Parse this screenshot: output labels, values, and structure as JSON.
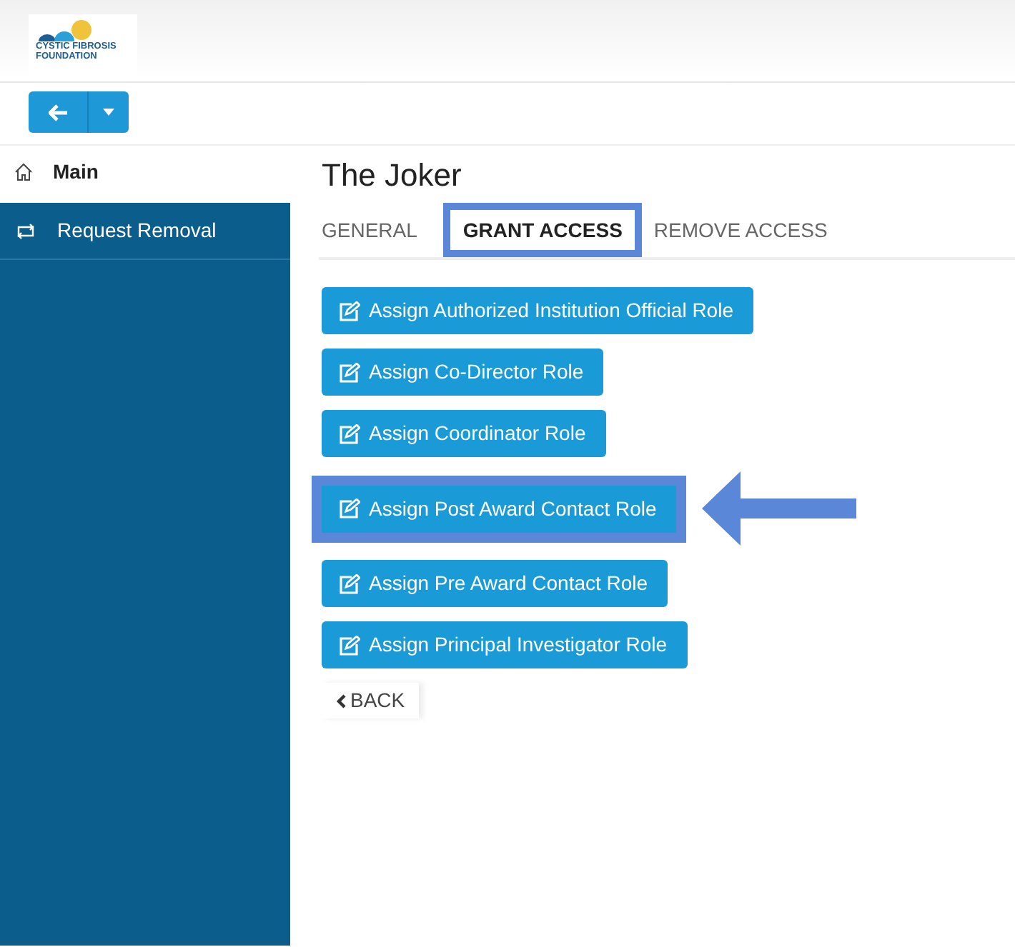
{
  "logo": {
    "line_1": "CYSTIC FIBROSIS",
    "line_2": "FOUNDATION"
  },
  "sidebar": {
    "items": [
      {
        "label": "Main",
        "selected": false
      },
      {
        "label": "Request Removal",
        "selected": true
      }
    ]
  },
  "page": {
    "title": "The Joker",
    "tabs": [
      {
        "label": "GENERAL",
        "selected": false,
        "highlighted": false
      },
      {
        "label": "GRANT ACCESS",
        "selected": true,
        "highlighted": true
      },
      {
        "label": "REMOVE ACCESS",
        "selected": false,
        "highlighted": false
      }
    ],
    "buttons": [
      {
        "label": "Assign Authorized Institution Official Role",
        "highlighted": false
      },
      {
        "label": "Assign Co-Director Role",
        "highlighted": false
      },
      {
        "label": "Assign Coordinator Role",
        "highlighted": false
      },
      {
        "label": "Assign Post Award Contact Role",
        "highlighted": true
      },
      {
        "label": "Assign Pre Award Contact Role",
        "highlighted": false
      },
      {
        "label": "Assign Principal Investigator Role",
        "highlighted": false
      }
    ],
    "back": {
      "label": "BACK"
    }
  }
}
